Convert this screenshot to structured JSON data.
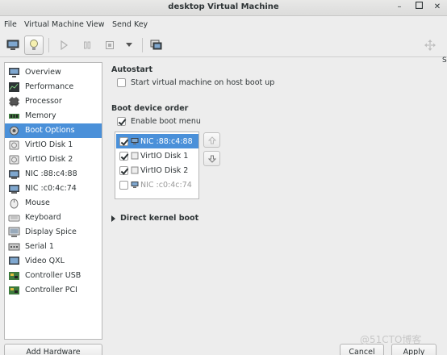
{
  "window": {
    "title": "desktop Virtual Machine"
  },
  "menu": [
    "File",
    "Virtual Machine",
    "View",
    "Send Key"
  ],
  "sidebar": {
    "items": [
      {
        "label": "Overview",
        "icon": "monitor-icon"
      },
      {
        "label": "Performance",
        "icon": "chart-icon"
      },
      {
        "label": "Processor",
        "icon": "cpu-icon"
      },
      {
        "label": "Memory",
        "icon": "memory-icon"
      },
      {
        "label": "Boot Options",
        "icon": "gear-icon",
        "selected": true
      },
      {
        "label": "VirtIO Disk 1",
        "icon": "disk-icon"
      },
      {
        "label": "VirtIO Disk 2",
        "icon": "disk-icon"
      },
      {
        "label": "NIC :88:c4:88",
        "icon": "nic-icon"
      },
      {
        "label": "NIC :c0:4c:74",
        "icon": "nic-icon"
      },
      {
        "label": "Mouse",
        "icon": "mouse-icon"
      },
      {
        "label": "Keyboard",
        "icon": "keyboard-icon"
      },
      {
        "label": "Display Spice",
        "icon": "display-icon"
      },
      {
        "label": "Serial 1",
        "icon": "serial-icon"
      },
      {
        "label": "Video QXL",
        "icon": "video-icon"
      },
      {
        "label": "Controller USB",
        "icon": "controller-icon"
      },
      {
        "label": "Controller PCI",
        "icon": "controller-icon"
      }
    ],
    "add_hardware": "Add Hardware"
  },
  "autostart": {
    "title": "Autostart",
    "option": "Start virtual machine on host boot up",
    "checked": false
  },
  "boot": {
    "title": "Boot device order",
    "enable_menu": "Enable boot menu",
    "enable_menu_checked": true,
    "devices": [
      {
        "label": "NIC :88:c4:88",
        "checked": true,
        "selected": true
      },
      {
        "label": "VirtIO Disk 1",
        "checked": true
      },
      {
        "label": "VirtIO Disk 2",
        "checked": true
      },
      {
        "label": "NIC :c0:4c:74",
        "checked": false,
        "disabled": true
      }
    ]
  },
  "direct_kernel": "Direct kernel boot",
  "buttons": {
    "cancel": "Cancel",
    "apply": "Apply"
  },
  "watermark": "@51CTO博客",
  "colors": {
    "selection": "#4a90d9"
  }
}
